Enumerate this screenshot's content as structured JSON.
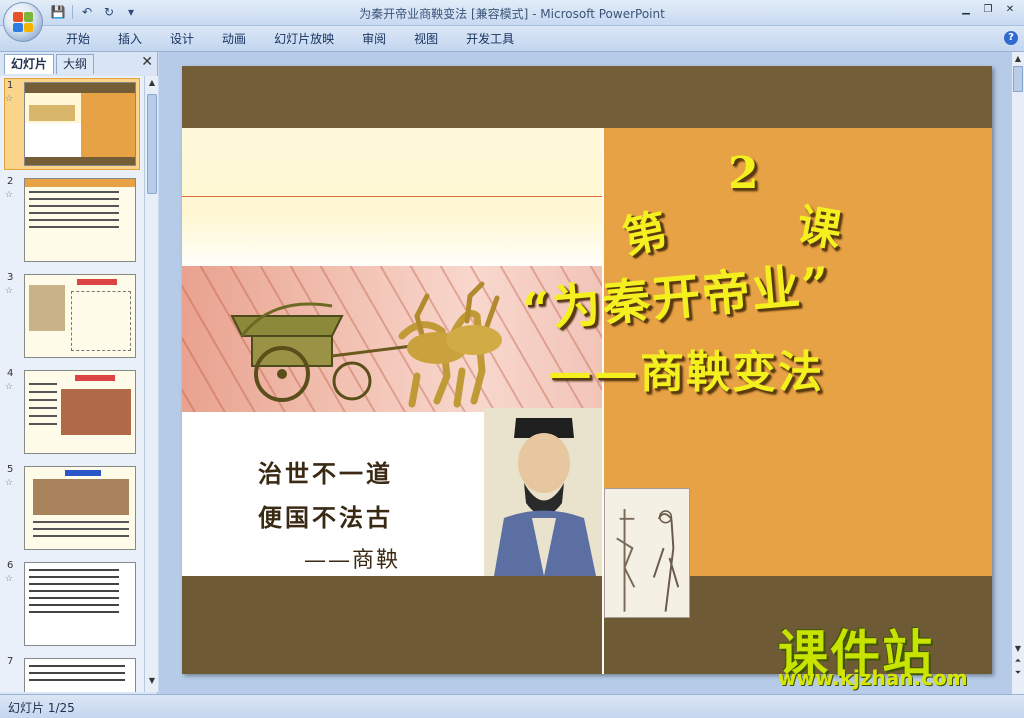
{
  "window": {
    "title": "为秦开帝业商鞅变法 [兼容模式] - Microsoft PowerPoint"
  },
  "ribbon": {
    "tabs": [
      "开始",
      "插入",
      "设计",
      "动画",
      "幻灯片放映",
      "审阅",
      "视图",
      "开发工具"
    ]
  },
  "left_panel": {
    "tabs": [
      "幻灯片",
      "大纲"
    ],
    "slides": [
      {
        "num": "1"
      },
      {
        "num": "2"
      },
      {
        "num": "3"
      },
      {
        "num": "4"
      },
      {
        "num": "5"
      },
      {
        "num": "6"
      },
      {
        "num": "7"
      }
    ]
  },
  "slide": {
    "lesson_di": "第",
    "lesson_num": "2",
    "lesson_ke": "课",
    "main_title": "“为秦开帝业”",
    "subtitle": "——商鞅变法",
    "quote_line1": "治世不一道",
    "quote_line2": "便国不法古",
    "quote_attrib": "——商鞅"
  },
  "watermark": {
    "brand": "课件站",
    "url": "www.kjzhan.com"
  },
  "statusbar": {
    "slide_info": "幻灯片 1/25"
  },
  "colors": {
    "slide_bg": "#735e38",
    "orange": "#e8a246",
    "title_yellow": "#f4ef1e"
  }
}
